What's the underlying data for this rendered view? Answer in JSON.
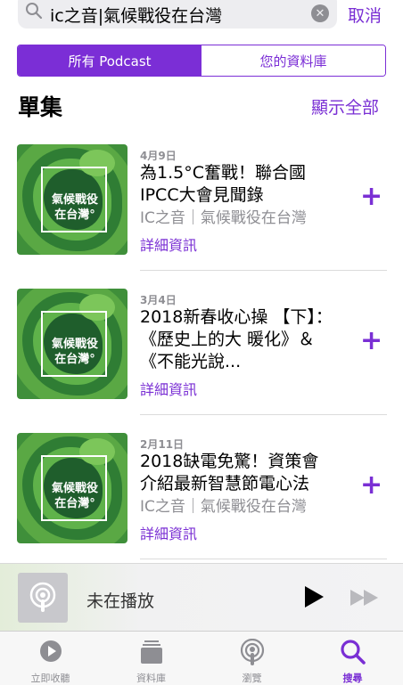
{
  "search": {
    "query": "ic之音|氣候戰役在台灣",
    "cancel_label": "取消"
  },
  "segments": [
    {
      "label": "所有 Podcast",
      "active": true
    },
    {
      "label": "您的資料庫",
      "active": false
    }
  ],
  "section": {
    "title": "單集",
    "show_all": "顯示全部"
  },
  "episodes": [
    {
      "date": "4月9日",
      "title": "為1.5°C奮戰！聯合國 IPCC大會見聞錄",
      "subtitle": "IC之音｜氣候戰役在台灣",
      "detail": "詳細資訊",
      "art_text": "氣候戰役\n在台灣°"
    },
    {
      "date": "3月4日",
      "title": "2018新春收心操 【下】：《歷史上的大 暖化》＆《不能光說...",
      "subtitle": "",
      "detail": "詳細資訊",
      "art_text": "氣候戰役\n在台灣°"
    },
    {
      "date": "2月11日",
      "title": "2018缺電免驚！資策會 介紹最新智慧節電心法",
      "subtitle": "IC之音｜氣候戰役在台灣",
      "detail": "詳細資訊",
      "art_text": "氣候戰役\n在台灣°"
    }
  ],
  "player": {
    "status": "未在播放"
  },
  "tabs": [
    {
      "label": "立即收聽",
      "icon": "listen-now-icon"
    },
    {
      "label": "資料庫",
      "icon": "library-icon"
    },
    {
      "label": "瀏覽",
      "icon": "browse-icon"
    },
    {
      "label": "搜尋",
      "icon": "search-icon",
      "active": true
    }
  ],
  "colors": {
    "accent": "#7a2fd4"
  }
}
